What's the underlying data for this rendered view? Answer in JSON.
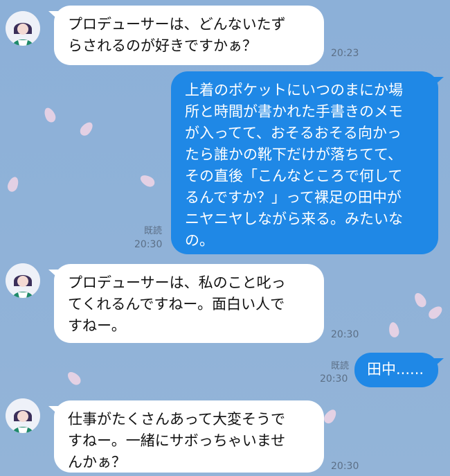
{
  "messages": [
    {
      "side": "left",
      "text": "プロデューサーは、どんないたず\nらされるのが好きですかぁ？",
      "time": "20:23"
    },
    {
      "side": "right",
      "text": "上着のポケットにいつのまにか場\n所と時間が書かれた手書きのメモ\nが入ってて、おそるおそる向かっ\nたら誰かの靴下だけが落ちてて、\nその直後「こんなところで何して\nるんですか？」って裸足の田中が\nニヤニヤしながら来る。みたいな\nの。",
      "time": "20:30",
      "read": "既読"
    },
    {
      "side": "left",
      "text": "プロデューサーは、私のこと叱っ\nてくれるんですねー。面白い人で\nすねー。",
      "time": "20:30"
    },
    {
      "side": "right",
      "text": "田中......",
      "time": "20:30",
      "read": "既読"
    },
    {
      "side": "left",
      "text": "仕事がたくさんあって大変そうで\nすねー。一緒にサボっちゃいませ\nんかぁ？",
      "time": "20:30"
    }
  ],
  "colors": {
    "background": "#8fb1d6",
    "right_bubble": "#1f88e6",
    "left_bubble": "#ffffff"
  },
  "icons": {
    "avatar": "character-avatar-icon"
  }
}
